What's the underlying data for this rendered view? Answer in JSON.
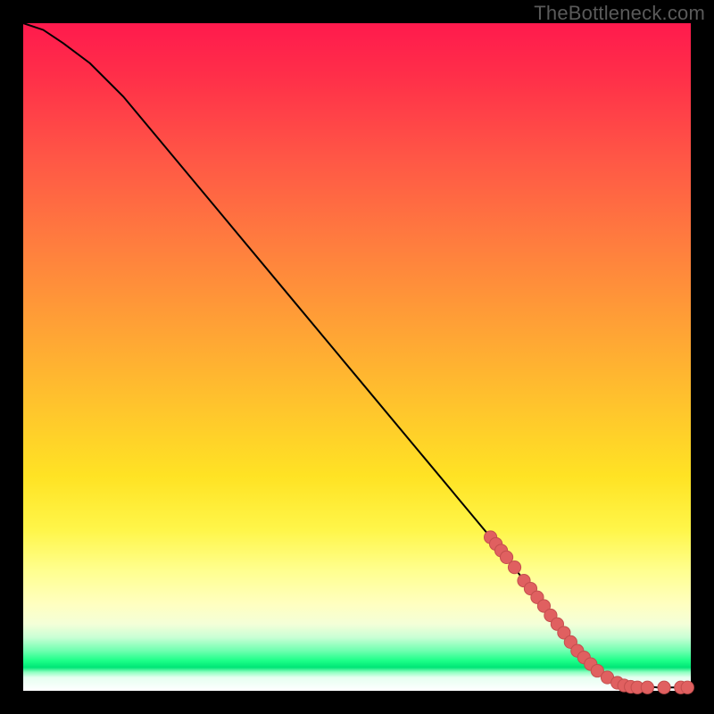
{
  "attribution": "TheBottleneck.com",
  "colors": {
    "background": "#000000",
    "curve": "#000000",
    "marker_fill": "#e06060",
    "marker_stroke": "#c44e4e"
  },
  "chart_data": {
    "type": "line",
    "title": "",
    "xlabel": "",
    "ylabel": "",
    "xlim": [
      0,
      100
    ],
    "ylim": [
      0,
      100
    ],
    "curve": {
      "x": [
        0,
        3,
        6,
        10,
        15,
        20,
        30,
        40,
        50,
        60,
        70,
        77,
        80,
        83,
        86,
        90,
        95,
        100
      ],
      "y": [
        100,
        99,
        97,
        94,
        89,
        83,
        71,
        59,
        47,
        35,
        23,
        14,
        10,
        6,
        3,
        1,
        0.5,
        0.5
      ]
    },
    "markers": [
      {
        "x": 70.0,
        "y": 23.0
      },
      {
        "x": 70.8,
        "y": 22.0
      },
      {
        "x": 71.6,
        "y": 21.0
      },
      {
        "x": 72.4,
        "y": 20.0
      },
      {
        "x": 73.6,
        "y": 18.5
      },
      {
        "x": 75.0,
        "y": 16.5
      },
      {
        "x": 76.0,
        "y": 15.3
      },
      {
        "x": 77.0,
        "y": 14.0
      },
      {
        "x": 78.0,
        "y": 12.7
      },
      {
        "x": 79.0,
        "y": 11.3
      },
      {
        "x": 80.0,
        "y": 10.0
      },
      {
        "x": 81.0,
        "y": 8.7
      },
      {
        "x": 82.0,
        "y": 7.3
      },
      {
        "x": 83.0,
        "y": 6.0
      },
      {
        "x": 84.0,
        "y": 5.0
      },
      {
        "x": 85.0,
        "y": 4.0
      },
      {
        "x": 86.0,
        "y": 3.0
      },
      {
        "x": 87.5,
        "y": 2.0
      },
      {
        "x": 89.0,
        "y": 1.2
      },
      {
        "x": 90.0,
        "y": 0.8
      },
      {
        "x": 91.0,
        "y": 0.6
      },
      {
        "x": 92.0,
        "y": 0.5
      },
      {
        "x": 93.5,
        "y": 0.5
      },
      {
        "x": 96.0,
        "y": 0.5
      },
      {
        "x": 98.5,
        "y": 0.5
      },
      {
        "x": 99.5,
        "y": 0.5
      }
    ]
  }
}
